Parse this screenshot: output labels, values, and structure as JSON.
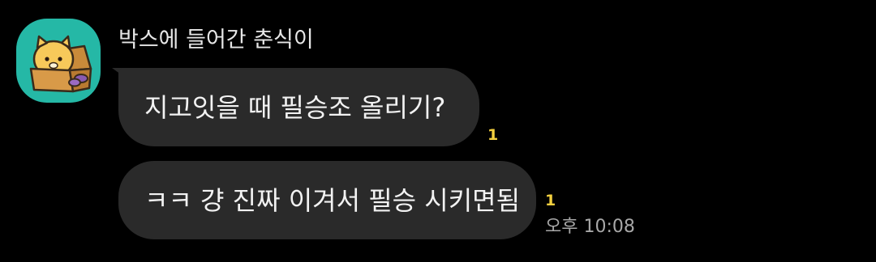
{
  "chat": {
    "sender_name": "박스에 들어간 춘식이",
    "avatar_icon": "cat-in-box-icon",
    "avatar_bg_color": "#25b8a6",
    "messages": [
      {
        "text": "지고잇을 때 필승조 올리기?",
        "unread": "1"
      },
      {
        "text": "ㅋㅋ 걍 진짜 이겨서 필승 시키면됨",
        "unread": "1"
      }
    ],
    "time": "오후 10:08",
    "unread_color": "#f4d03f",
    "bubble_color": "#2a2a2a"
  }
}
